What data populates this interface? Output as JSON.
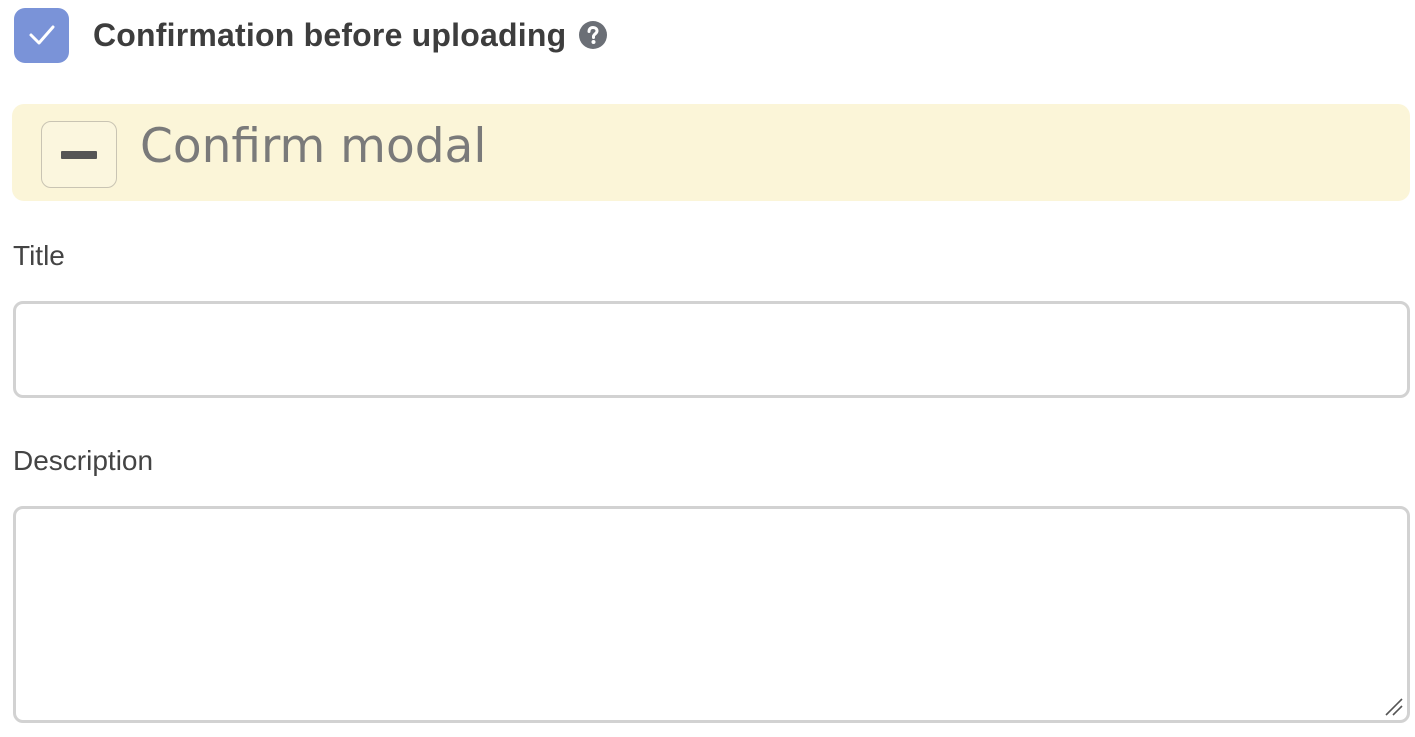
{
  "confirmation": {
    "label": "Confirmation before uploading",
    "checked": true,
    "checkbox_color": "#7a93d8",
    "help_icon": "question-circle-icon"
  },
  "section": {
    "title": "Confirm modal",
    "background_color": "#fbf5d8",
    "toggle_icon": "minus-icon"
  },
  "fields": {
    "title": {
      "label": "Title",
      "value": "",
      "placeholder": ""
    },
    "description": {
      "label": "Description",
      "value": "",
      "placeholder": ""
    }
  }
}
